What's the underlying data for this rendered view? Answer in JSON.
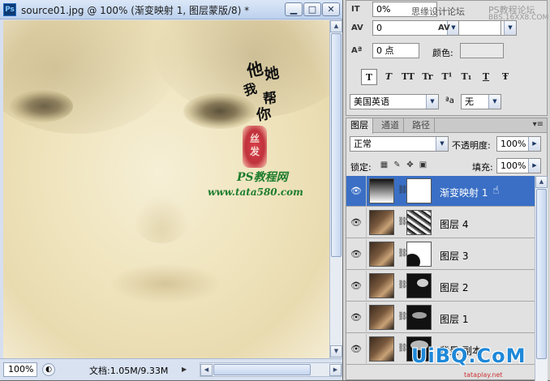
{
  "document": {
    "title": "source01.jpg @ 100% (渐变映射 1, 图层蒙版/8) *",
    "min_label": "▁",
    "max_label": "□",
    "close_label": "✕",
    "canvas_calligraphy": [
      "他",
      "她",
      "我",
      "帮",
      "你"
    ],
    "seal_text": "丝发",
    "watermark_line1": "PS教程网",
    "watermark_line2": "www.tata580.com",
    "zoom": "100%",
    "doc_info": "文档:1.05M/9.33M"
  },
  "character_panel": {
    "tracking_value": "0%",
    "kerning_value": "0",
    "baseline_value": "0 点",
    "color_label": "颜色:",
    "format_buttons": [
      "T",
      "T",
      "TT",
      "Tr",
      "T¹",
      "T₁",
      "T",
      "Ŧ"
    ],
    "language": "美国英语",
    "antialias_icon_label": "ªa",
    "antialias": "无",
    "promo_text": "思缘设计论坛",
    "corner_text1": "PS教程论坛",
    "corner_text2": "BBS.16XX8.COM"
  },
  "layers_panel": {
    "tabs": [
      "图层",
      "通道",
      "路径"
    ],
    "menu_icon": "▾≡",
    "blend_mode": "正常",
    "opacity_label": "不透明度:",
    "opacity": "100%",
    "lock_label": "锁定:",
    "fill_label": "填充:",
    "fill": "100%",
    "layers": [
      {
        "name": "渐变映射 1",
        "selected": true,
        "thumb": "gradient-map",
        "mask": "white"
      },
      {
        "name": "图层 4",
        "selected": false,
        "thumb": "photo",
        "mask": "texture"
      },
      {
        "name": "图层 3",
        "selected": false,
        "thumb": "photo",
        "mask": "white-shape"
      },
      {
        "name": "图层 2",
        "selected": false,
        "thumb": "photo",
        "mask": "dark-shape"
      },
      {
        "name": "图层 1",
        "selected": false,
        "thumb": "photo",
        "mask": "dark-shape"
      },
      {
        "name": "背景 副本",
        "selected": false,
        "thumb": "photo",
        "mask": "dark-shape"
      }
    ]
  },
  "brand": {
    "text": "UiBQ.CoM",
    "sub": "tataplay.net"
  },
  "icons": {
    "eye": "eye-icon",
    "chain": "chain-link-icon",
    "lock": [
      "lock-transparent-icon",
      "brush-icon",
      "move-icon",
      "lock-all-icon"
    ]
  }
}
